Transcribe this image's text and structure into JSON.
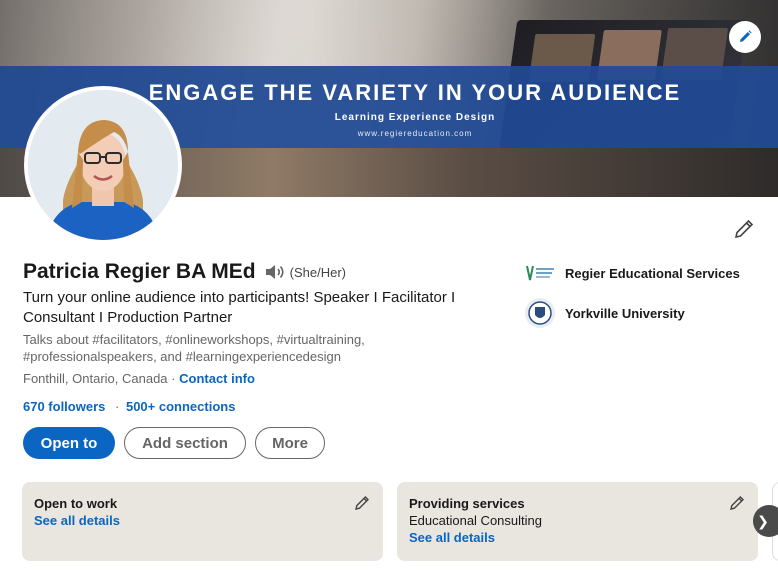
{
  "banner": {
    "headline": "ENGAGE THE VARIETY IN YOUR AUDIENCE",
    "subtitle": "Learning Experience Design",
    "website": "www.regiereducation.com"
  },
  "profile": {
    "name": "Patricia Regier BA MEd",
    "pronouns": "(She/Her)",
    "headline": "Turn your online audience into participants! Speaker I Facilitator I Consultant I Production Partner",
    "talks_about": "Talks about #facilitators, #onlineworkshops, #virtualtraining, #professionalspeakers, and #learningexperiencedesign",
    "location": "Fonthill, Ontario, Canada",
    "location_sep": "·",
    "contact_info": "Contact info",
    "followers": "670 followers",
    "stats_sep": "·",
    "connections": "500+ connections"
  },
  "buttons": {
    "open_to": "Open to",
    "add_section": "Add section",
    "more": "More"
  },
  "organizations": [
    {
      "name": "Regier Educational Services",
      "logo": "regier-logo-icon"
    },
    {
      "name": "Yorkville University",
      "logo": "yorkville-crest-icon"
    }
  ],
  "cards": [
    {
      "title": "Open to work",
      "subtitle": "",
      "link": "See all details"
    },
    {
      "title": "Providing services",
      "subtitle": "Educational Consulting",
      "link": "See all details"
    }
  ],
  "carousel": {
    "next_glyph": "❯"
  },
  "colors": {
    "accent": "#0a66c2",
    "banner_strip": "#204a96",
    "card_bg": "#e9e5df"
  }
}
